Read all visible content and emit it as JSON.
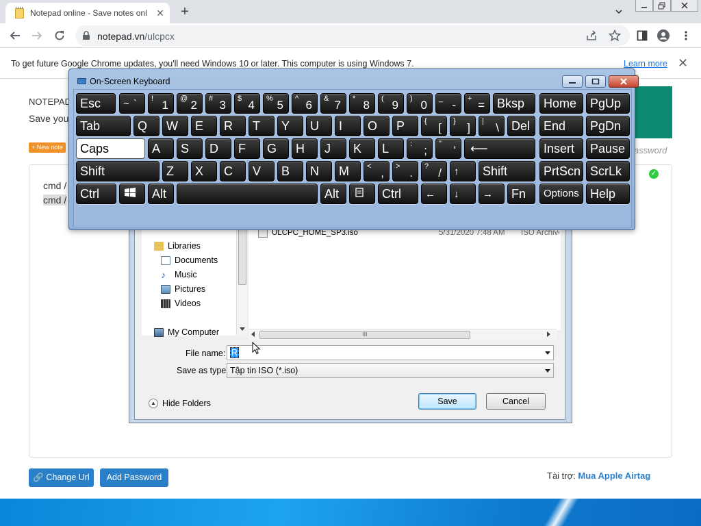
{
  "browser": {
    "tab_title": "Notepad online - Save notes onl",
    "url_host": "notepad.vn",
    "url_path": "/ulcpcx",
    "new_tab": "+",
    "tab_close": "✕",
    "info_bar": {
      "text": "To get future Google Chrome updates, you'll need Windows 10 or later. This computer is using Windows 7.",
      "link": "Learn more",
      "close": "✕"
    }
  },
  "page": {
    "site_label": "NOTEPAD",
    "subtitle": "Save you",
    "new_note_badge": "+ New note",
    "password_label": "assword",
    "editor_lines": [
      "cmd /",
      "cmd /"
    ],
    "check": "✓",
    "buttons": {
      "change_url": "Change Url",
      "add_password": "Add Password"
    },
    "sponsor_label": "Tài trợ:",
    "sponsor_link": "Mua Apple Airtag"
  },
  "save_dialog": {
    "nav_items": [
      "Libraries",
      "Documents",
      "Music",
      "Pictures",
      "Videos",
      "My Computer"
    ],
    "file": {
      "name": "ULCPC_HOME_SP3.iso",
      "date": "5/31/2020 7:48 AM",
      "type": "ISO Archive"
    },
    "file_name_label": "File name:",
    "file_name_value": "R",
    "save_type_label": "Save as type:",
    "save_type_value": "Tập tin ISO (*.iso)",
    "hide_folders": "Hide Folders",
    "save": "Save",
    "cancel": "Cancel",
    "scroll_grip": "III"
  },
  "osk": {
    "title": "On-Screen Keyboard",
    "keys": {
      "esc": "Esc",
      "tilde": "~",
      "grave": "`",
      "bksp": "Bksp",
      "home": "Home",
      "pgup": "PgUp",
      "tab": "Tab",
      "del": "Del",
      "end": "End",
      "pgdn": "PgDn",
      "caps": "Caps",
      "enter": "⟵",
      "insert": "Insert",
      "pause": "Pause",
      "shift_l": "Shift",
      "up": "↑",
      "shift_r": "Shift",
      "prtscn": "PrtScn",
      "scrlk": "ScrLk",
      "ctrl_l": "Ctrl",
      "alt_l": "Alt",
      "alt_r": "Alt",
      "ctrl_r": "Ctrl",
      "left": "←",
      "down": "↓",
      "right": "→",
      "fn": "Fn",
      "options": "Options",
      "help": "Help",
      "digits": [
        [
          "!",
          "1"
        ],
        [
          "@",
          "2"
        ],
        [
          "#",
          "3"
        ],
        [
          "$",
          "4"
        ],
        [
          "%",
          "5"
        ],
        [
          "^",
          "6"
        ],
        [
          "&",
          "7"
        ],
        [
          "*",
          "8"
        ],
        [
          "(",
          "9"
        ],
        [
          ")",
          "0"
        ],
        [
          "_",
          "-"
        ],
        [
          "+",
          "="
        ]
      ],
      "row2": [
        "Q",
        "W",
        "E",
        "R",
        "T",
        "Y",
        "U",
        "I",
        "O",
        "P"
      ],
      "row2_sym": [
        [
          "{",
          "["
        ],
        [
          "}",
          "]"
        ],
        [
          "|",
          "\\"
        ]
      ],
      "row3": [
        "A",
        "S",
        "D",
        "F",
        "G",
        "H",
        "J",
        "K",
        "L"
      ],
      "row3_sym": [
        [
          ":",
          ";"
        ],
        [
          "\"",
          "'"
        ]
      ],
      "row4": [
        "Z",
        "X",
        "C",
        "V",
        "B",
        "N",
        "M"
      ],
      "row4_sym": [
        [
          "<",
          ","
        ],
        [
          ">",
          "."
        ],
        [
          "?",
          "/"
        ]
      ]
    }
  }
}
